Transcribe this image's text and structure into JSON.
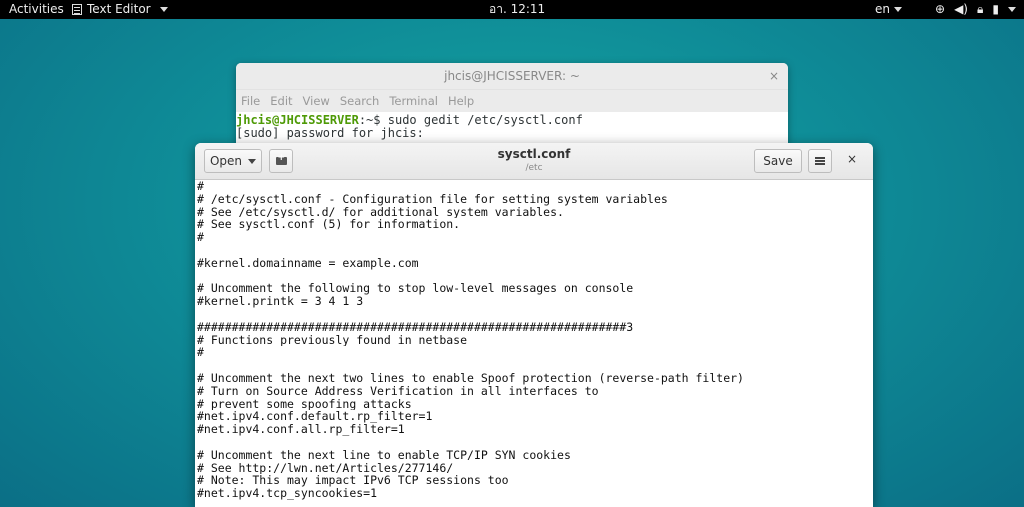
{
  "topbar": {
    "activities": "Activities",
    "app_name": "Text Editor",
    "clock": "อา. 12:11",
    "lang": "en",
    "icons": [
      "network-icon",
      "volume-icon",
      "lock-icon",
      "battery-icon"
    ]
  },
  "terminal": {
    "title": "jhcis@JHCISSERVER: ~",
    "close": "×",
    "menu": [
      "File",
      "Edit",
      "View",
      "Search",
      "Terminal",
      "Help"
    ],
    "prompt_user": "jhcis@JHCISSERVER",
    "prompt_path": ":~$",
    "command": " sudo gedit /etc/sysctl.conf",
    "line2": "[sudo] password for jhcis:"
  },
  "gedit": {
    "open_label": "Open",
    "title": "sysctl.conf",
    "subtitle": "/etc",
    "save_label": "Save",
    "close": "×",
    "lines": [
      "#",
      "# /etc/sysctl.conf - Configuration file for setting system variables",
      "# See /etc/sysctl.d/ for additional system variables.",
      "# See sysctl.conf (5) for information.",
      "#",
      "",
      "#kernel.domainname = example.com",
      "",
      "# Uncomment the following to stop low-level messages on console",
      "#kernel.printk = 3 4 1 3",
      "",
      "##############################################################3",
      "# Functions previously found in netbase",
      "#",
      "",
      "# Uncomment the next two lines to enable Spoof protection (reverse-path filter)",
      "# Turn on Source Address Verification in all interfaces to",
      "# prevent some spoofing attacks",
      "#net.ipv4.conf.default.rp_filter=1",
      "#net.ipv4.conf.all.rp_filter=1",
      "",
      "# Uncomment the next line to enable TCP/IP SYN cookies",
      "# See http://lwn.net/Articles/277146/",
      "# Note: This may impact IPv6 TCP sessions too",
      "#net.ipv4.tcp_syncookies=1"
    ]
  }
}
